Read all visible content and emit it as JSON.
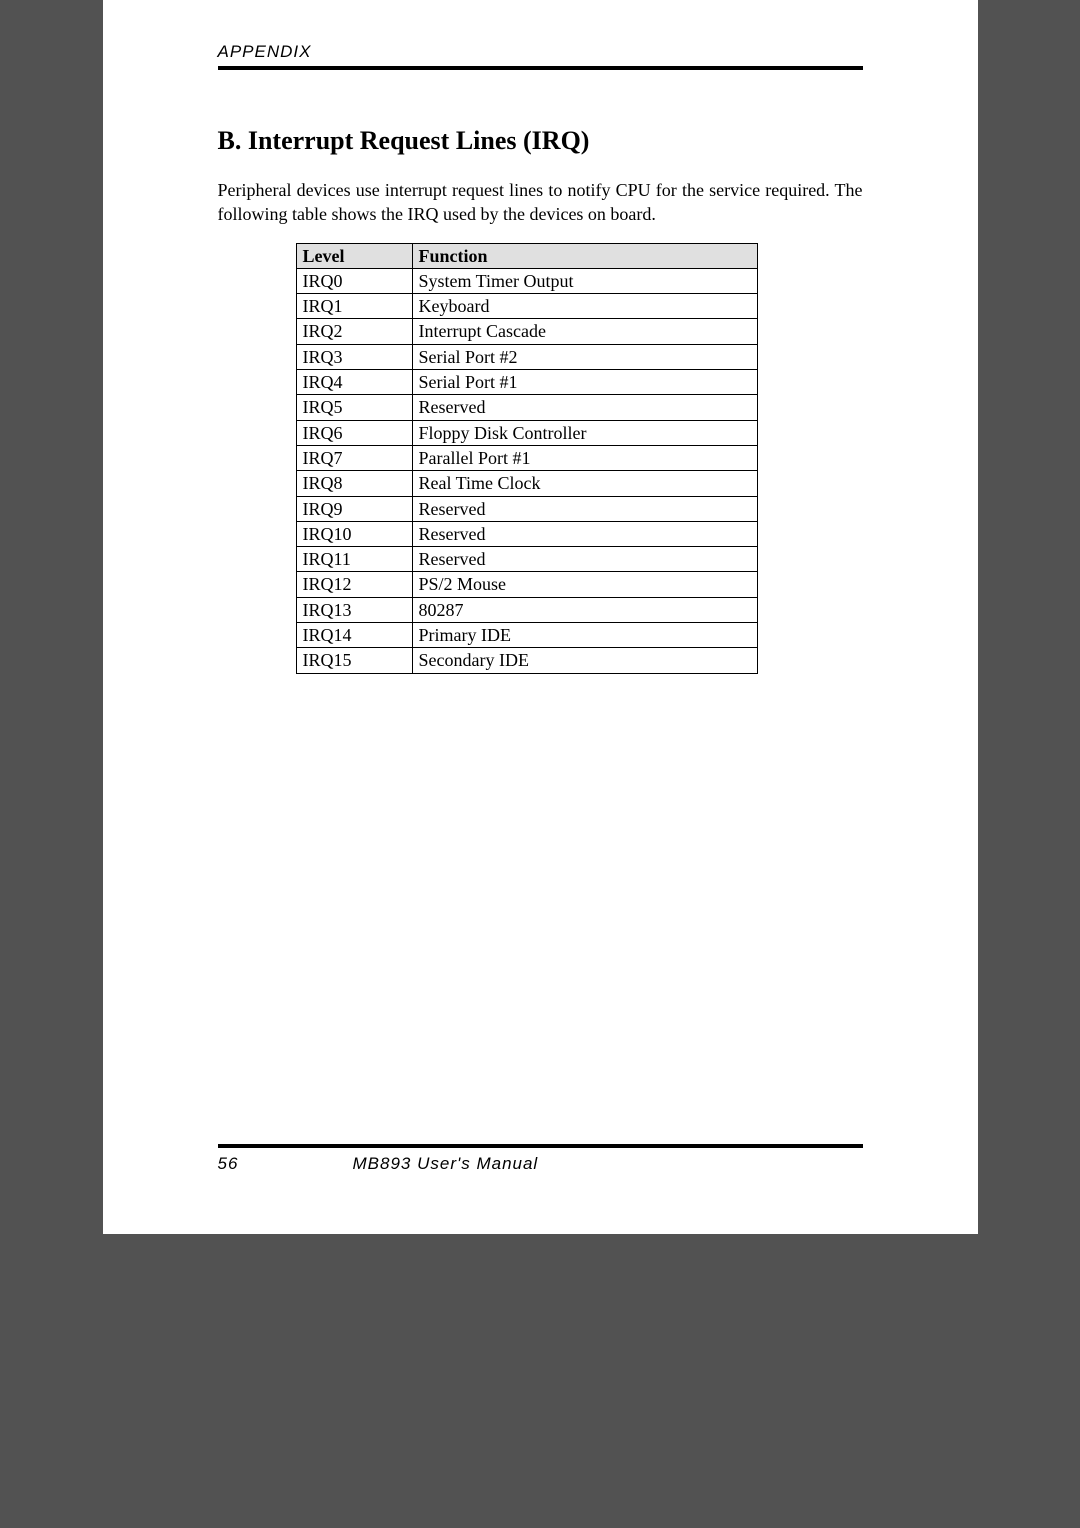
{
  "header": {
    "label": "APPENDIX"
  },
  "section": {
    "title": "B. Interrupt Request Lines (IRQ)",
    "intro": "Peripheral devices use interrupt request lines to notify CPU for the service required. The following table shows the IRQ used by the devices on board."
  },
  "table": {
    "headers": {
      "level": "Level",
      "function": "Function"
    },
    "rows": [
      {
        "level": "IRQ0",
        "function": "System Timer Output"
      },
      {
        "level": "IRQ1",
        "function": "Keyboard"
      },
      {
        "level": "IRQ2",
        "function": "Interrupt Cascade"
      },
      {
        "level": "IRQ3",
        "function": "Serial Port #2"
      },
      {
        "level": "IRQ4",
        "function": "Serial Port #1"
      },
      {
        "level": "IRQ5",
        "function": "Reserved"
      },
      {
        "level": "IRQ6",
        "function": "Floppy Disk Controller"
      },
      {
        "level": "IRQ7",
        "function": "Parallel Port #1"
      },
      {
        "level": "IRQ8",
        "function": "Real Time Clock"
      },
      {
        "level": "IRQ9",
        "function": "Reserved"
      },
      {
        "level": "IRQ10",
        "function": "Reserved"
      },
      {
        "level": "IRQ11",
        "function": "Reserved"
      },
      {
        "level": "IRQ12",
        "function": "PS/2 Mouse"
      },
      {
        "level": "IRQ13",
        "function": "80287"
      },
      {
        "level": "IRQ14",
        "function": "Primary IDE"
      },
      {
        "level": "IRQ15",
        "function": "Secondary IDE"
      }
    ]
  },
  "footer": {
    "page_number": "56",
    "manual": "MB893 User's Manual"
  }
}
